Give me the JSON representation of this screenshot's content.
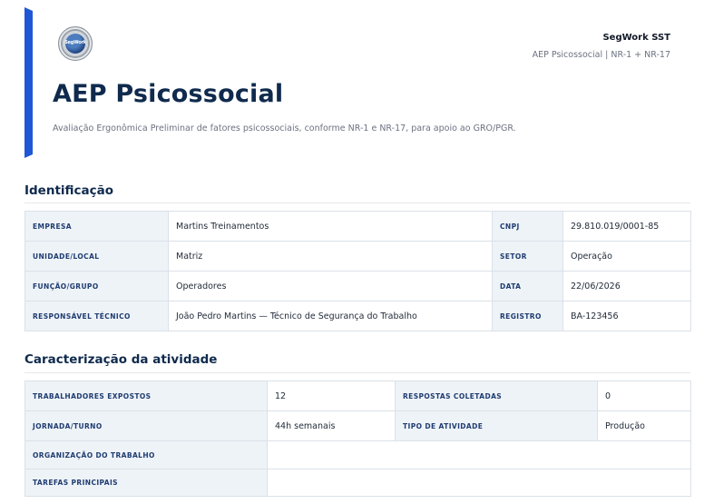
{
  "header": {
    "brand_name": "SegWork SST",
    "brand_subtitle": "AEP Psicossocial | NR-1 + NR-17",
    "logo_text": "SegWork",
    "title": "AEP Psicossocial",
    "description": "Avaliação Ergonômica Preliminar de fatores psicossociais, conforme NR-1 e NR-17, para apoio ao GRO/PGR."
  },
  "identificacao": {
    "title": "Identificação",
    "rows": [
      {
        "label1": "EMPRESA",
        "value1": "Martins Treinamentos",
        "label2": "CNPJ",
        "value2": "29.810.019/0001-85"
      },
      {
        "label1": "UNIDADE/LOCAL",
        "value1": "Matriz",
        "label2": "SETOR",
        "value2": "Operação"
      },
      {
        "label1": "FUNÇÃO/GRUPO",
        "value1": "Operadores",
        "label2": "DATA",
        "value2": "22/06/2026"
      },
      {
        "label1": "RESPONSÁVEL TÉCNICO",
        "value1": "João Pedro Martins — Técnico de Segurança do Trabalho",
        "label2": "REGISTRO",
        "value2": "BA-123456"
      }
    ]
  },
  "caracterizacao": {
    "title": "Caracterização da atividade",
    "rows": [
      {
        "label1": "TRABALHADORES EXPOSTOS",
        "value1": "12",
        "label2": "RESPOSTAS COLETADAS",
        "value2": "0"
      },
      {
        "label1": "JORNADA/TURNO",
        "value1": "44h semanais",
        "label2": "TIPO DE ATIVIDADE",
        "value2": "Produção"
      }
    ],
    "wide_rows": [
      {
        "label": "ORGANIZAÇÃO DO TRABALHO",
        "value": ""
      },
      {
        "label": "TAREFAS PRINCIPAIS",
        "value": ""
      }
    ]
  },
  "colors": {
    "accent": "#1f57d6",
    "title": "#0f2a4d",
    "label_bg": "#eef3f8",
    "label_text": "#1f3c70"
  }
}
